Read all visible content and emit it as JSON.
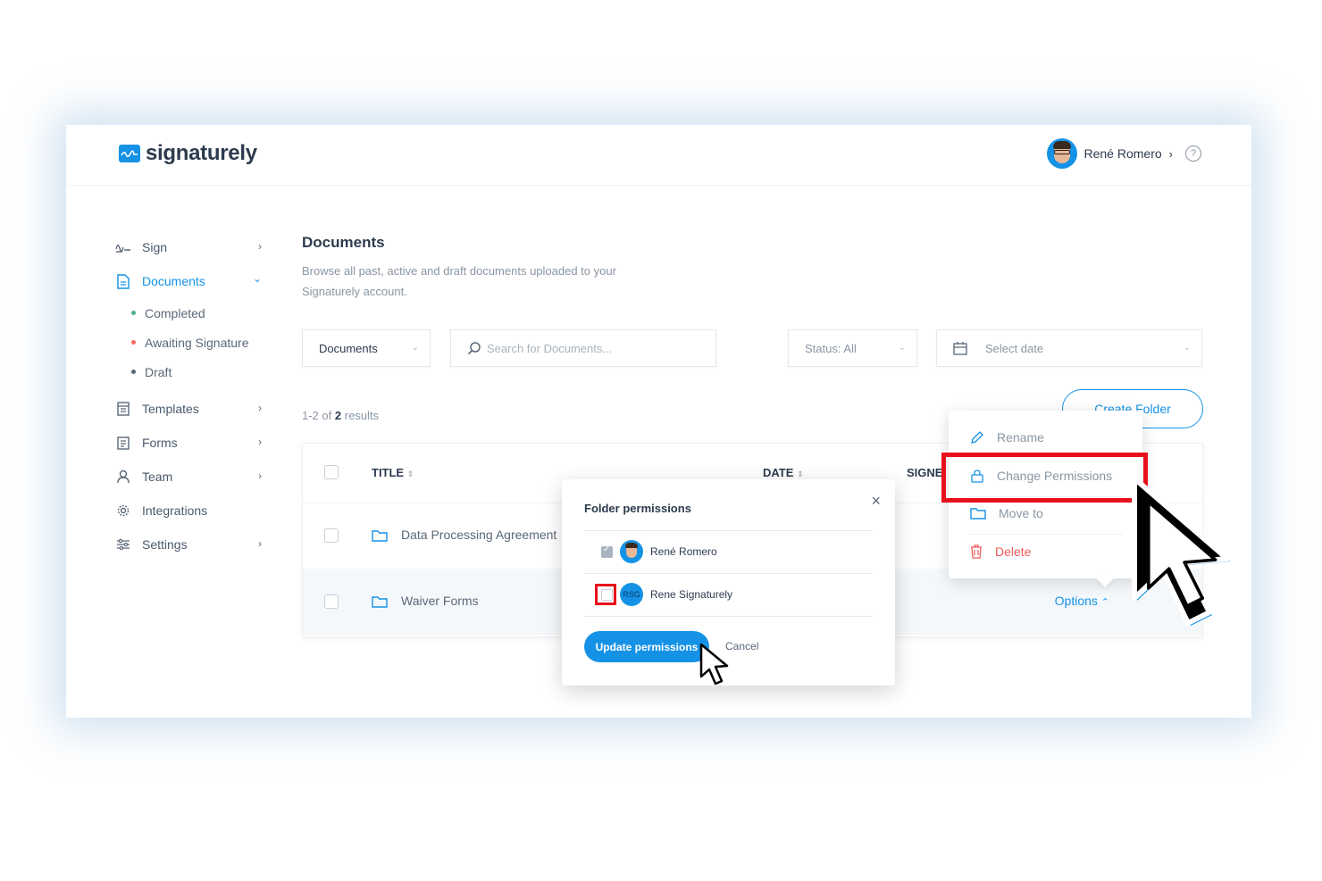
{
  "app": {
    "name": "signaturely"
  },
  "user": {
    "name": "René Romero",
    "help": "?"
  },
  "sidebar": {
    "sign": "Sign",
    "documents": "Documents",
    "sub": [
      {
        "label": "Completed",
        "color": "#4caf91"
      },
      {
        "label": "Awaiting Signature",
        "color": "#f26b5b"
      },
      {
        "label": "Draft",
        "color": "#5a6878"
      }
    ],
    "templates": "Templates",
    "forms": "Forms",
    "team": "Team",
    "integrations": "Integrations",
    "settings": "Settings"
  },
  "page": {
    "title": "Documents",
    "description": "Browse all past, active and draft documents uploaded to your Signaturely account."
  },
  "filters": {
    "type": "Documents",
    "search_placeholder": "Search for Documents...",
    "status": "Status: All",
    "date": "Select date"
  },
  "results": {
    "prefix": "1-2 of",
    "count": "2",
    "suffix": "results"
  },
  "create_folder": "Create Folder",
  "table": {
    "col_title": "TITLE",
    "col_date": "DATE",
    "col_signers": "SIGNE",
    "rows": [
      {
        "title": "Data Processing Agreement"
      },
      {
        "title": "Waiver Forms",
        "options": "Options"
      }
    ]
  },
  "context_menu": {
    "rename": "Rename",
    "change_permissions": "Change Permissions",
    "move_to": "Move to",
    "delete": "Delete"
  },
  "modal": {
    "title": "Folder permissions",
    "users": [
      {
        "name": "René Romero",
        "checked": true
      },
      {
        "name": "Rene Signaturely",
        "initials": "RSG",
        "checked": false
      }
    ],
    "update_button": "Update permissions",
    "cancel_button": "Cancel"
  },
  "colors": {
    "brand": "#1592e6",
    "danger": "#f15a5a",
    "highlight": "#e8101a"
  }
}
